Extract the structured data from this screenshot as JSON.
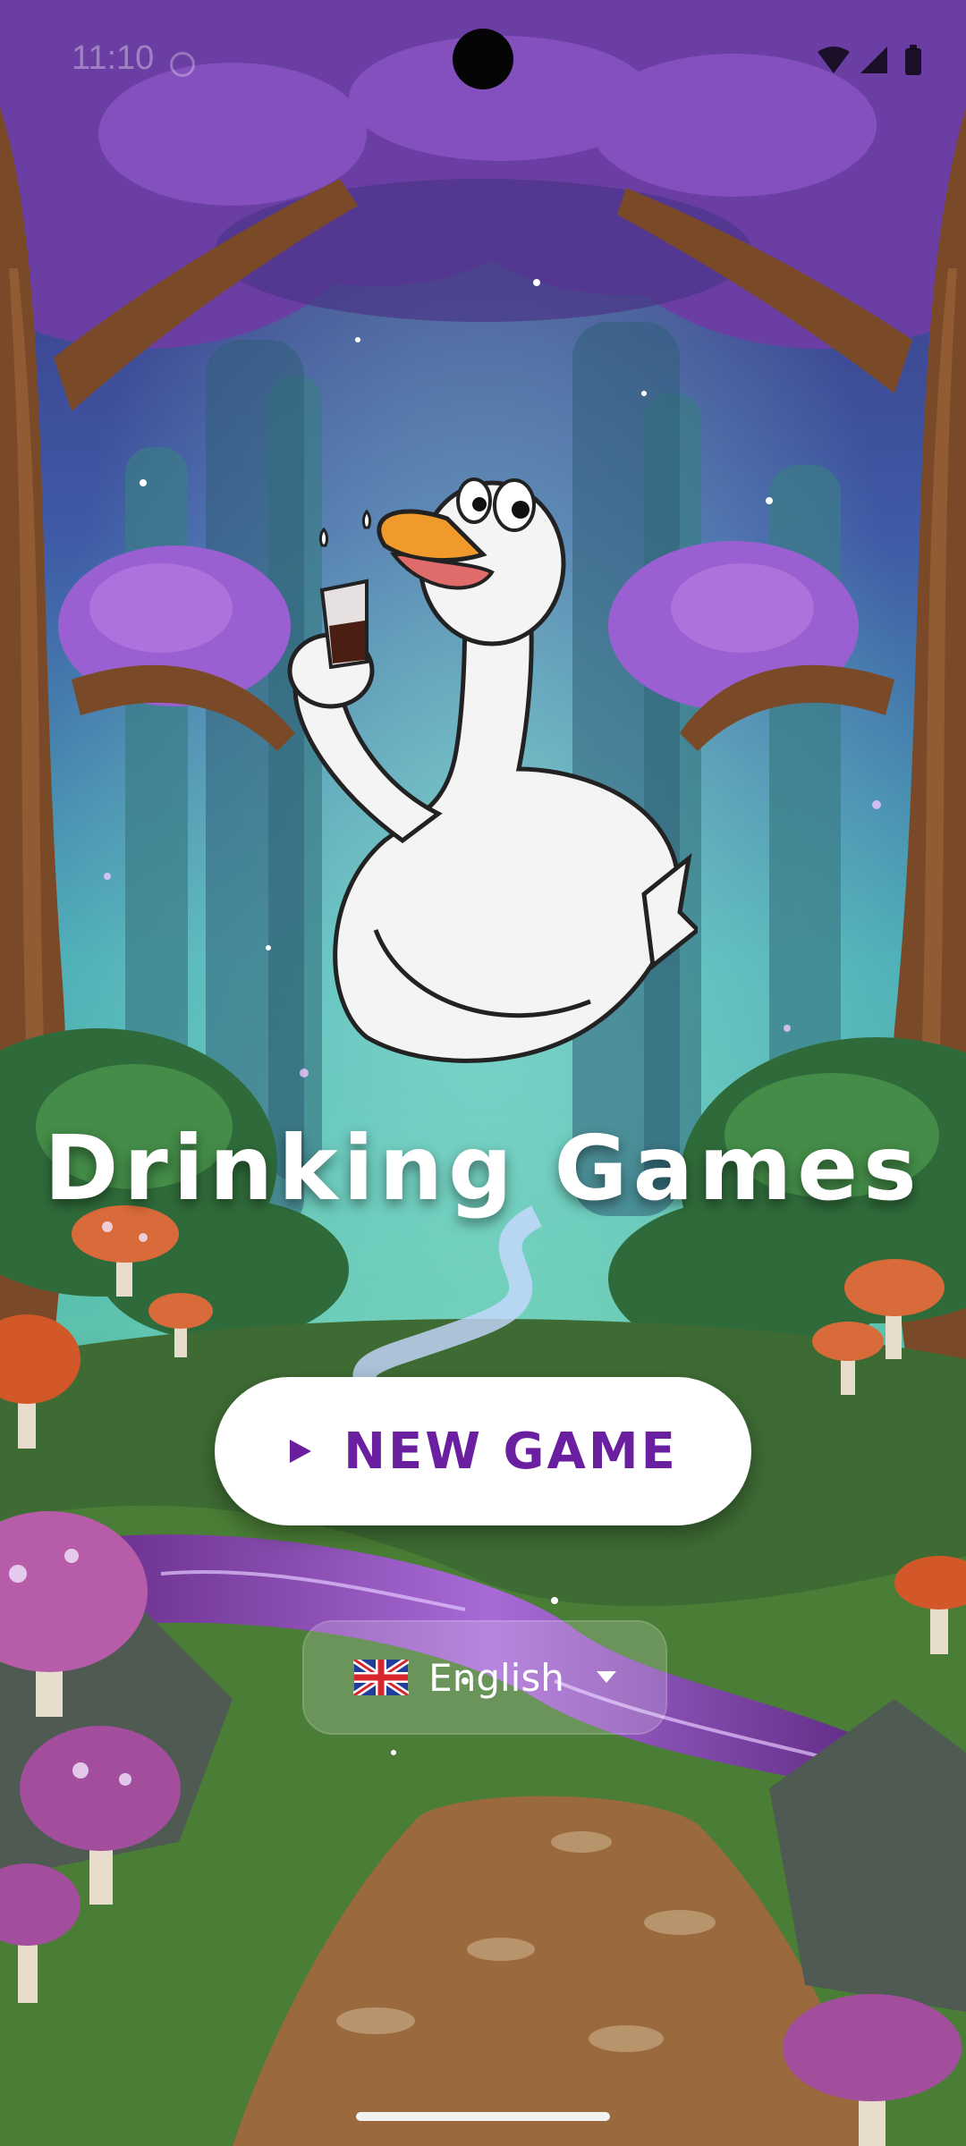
{
  "status_bar": {
    "time": "11:10",
    "icons": [
      "wifi-icon",
      "signal-icon",
      "battery-icon"
    ]
  },
  "app": {
    "title": "Drinking Games",
    "mascot": "goose-with-shot-glass-illustration"
  },
  "actions": {
    "new_game_label": "NEW GAME",
    "new_game_icon": "play-icon"
  },
  "language": {
    "selected": "English",
    "flag": "uk-flag-icon",
    "dropdown_icon": "caret-down-icon"
  },
  "colors": {
    "accent": "#6a1fa0",
    "button_bg": "#ffffff",
    "title_text": "#ffffff"
  }
}
